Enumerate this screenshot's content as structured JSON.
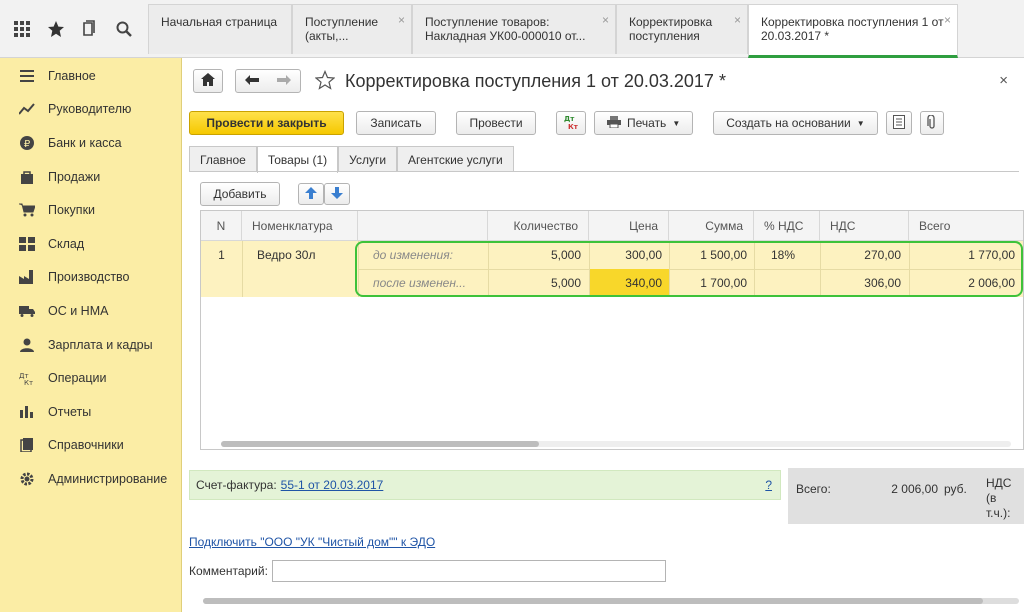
{
  "topbar": {
    "icons": [
      "grid-icon",
      "star-icon",
      "history-icon",
      "search-icon"
    ],
    "tabs": [
      {
        "label": "Начальная страница",
        "closable": false
      },
      {
        "label": "Поступление (акты,...",
        "closable": true
      },
      {
        "label": "Поступление товаров: Накладная УК00-000010 от...",
        "closable": true
      },
      {
        "label": "Корректировка поступления",
        "closable": true
      },
      {
        "label": "Корректировка поступления 1 от 20.03.2017 *",
        "closable": true
      }
    ]
  },
  "sidebar": {
    "items": [
      {
        "label": "Главное",
        "icon": "menu-icon"
      },
      {
        "label": "Руководителю",
        "icon": "trend-icon"
      },
      {
        "label": "Банк и касса",
        "icon": "ruble-icon"
      },
      {
        "label": "Продажи",
        "icon": "bag-icon"
      },
      {
        "label": "Покупки",
        "icon": "cart-icon"
      },
      {
        "label": "Склад",
        "icon": "warehouse-icon"
      },
      {
        "label": "Производство",
        "icon": "factory-icon"
      },
      {
        "label": "ОС и НМА",
        "icon": "truck-icon"
      },
      {
        "label": "Зарплата и кадры",
        "icon": "person-icon"
      },
      {
        "label": "Операции",
        "icon": "dtkt-icon"
      },
      {
        "label": "Отчеты",
        "icon": "bars-icon"
      },
      {
        "label": "Справочники",
        "icon": "book-icon"
      },
      {
        "label": "Администрирование",
        "icon": "gear-icon"
      }
    ]
  },
  "header": {
    "title": "Корректировка поступления 1 от 20.03.2017 *",
    "close": "×"
  },
  "toolbar": {
    "post_close": "Провести и закрыть",
    "save": "Записать",
    "post": "Провести",
    "dtkt": "ДтКт",
    "print": "Печать",
    "create_based": "Создать на основании"
  },
  "form_tabs": [
    "Главное",
    "Товары (1)",
    "Услуги",
    "Агентские услуги"
  ],
  "table_toolbar": {
    "add": "Добавить"
  },
  "table": {
    "headers": [
      "N",
      "Номенклатура",
      "",
      "Количество",
      "Цена",
      "Сумма",
      "% НДС",
      "НДС",
      "Всего"
    ],
    "row": {
      "n": "1",
      "item": "Ведро 30л",
      "before": {
        "label": "до изменения:",
        "qty": "5,000",
        "price": "300,00",
        "sum": "1 500,00",
        "vat_rate": "18%",
        "vat": "270,00",
        "total": "1 770,00"
      },
      "after": {
        "label": "после изменен...",
        "qty": "5,000",
        "price": "340,00",
        "sum": "1 700,00",
        "vat_rate": "",
        "vat": "306,00",
        "total": "2 006,00"
      }
    }
  },
  "invoice": {
    "label": "Счет-фактура:",
    "link": "55-1 от 20.03.2017",
    "help": "?"
  },
  "totals": {
    "total_label": "Всего:",
    "total_value": "2 006,00",
    "currency": "руб.",
    "vat_label": "НДС (в т.ч.):"
  },
  "edo_link": "Подключить \"ООО \"УК \"Чистый дом\"\" к ЭДО",
  "comment": {
    "label": "Комментарий:",
    "value": ""
  }
}
